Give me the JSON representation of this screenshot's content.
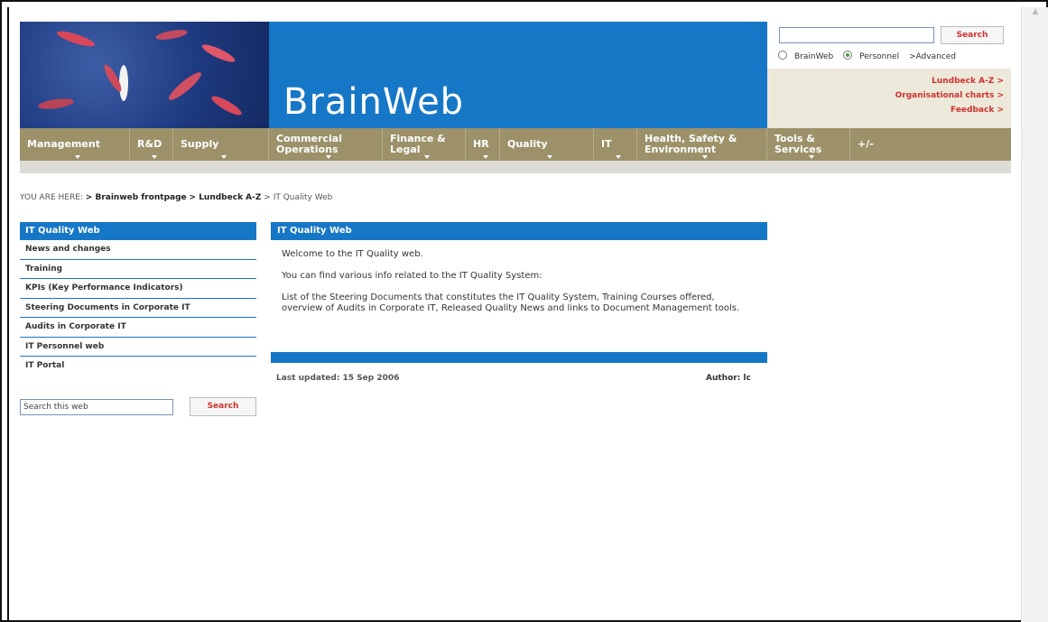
{
  "header": {
    "brand": "BrainWeb",
    "search": {
      "button": "Search",
      "value": ""
    },
    "scope_options": [
      "BrainWeb",
      "Personnel"
    ],
    "advanced": ">Advanced",
    "quick_links": [
      "Lundbeck A-Z >",
      "Organisational charts >",
      "Feedback >"
    ]
  },
  "nav": [
    "Management",
    "R&D",
    "Supply",
    "Commercial Operations",
    "Finance & Legal",
    "HR",
    "Quality",
    "IT",
    "Health, Safety & Environment",
    "Tools & Services",
    "+/-"
  ],
  "breadcrumb": {
    "prefix": "YOU ARE HERE:",
    "items": [
      "> Brainweb frontpage",
      "> Lundbeck A-Z",
      "> IT Quality Web"
    ]
  },
  "sidebar": {
    "title": "IT Quality Web",
    "items": [
      "News and changes",
      "Training",
      "KPIs (Key Performance Indicators)",
      "Steering Documents in Corporate IT",
      "Audits in Corporate IT",
      "IT Personnel web",
      "IT Portal"
    ],
    "search_value": "Search this web",
    "search_button": "Search"
  },
  "main": {
    "title": "IT Quality Web",
    "paragraphs": [
      "Welcome to the IT Quality web.",
      "You can find various info related to the IT Quality System:",
      "List of the Steering Documents that constitutes the IT Quality System, Training Courses offered, overview of Audits in Corporate IT, Released Quality News and links to Document Management tools."
    ],
    "updated": "Last updated: 15 Sep 2006",
    "author": "Author: lc"
  },
  "colors": {
    "accent_blue": "#1677c6",
    "nav_khaki": "#9c9169",
    "link_red": "#d0312d",
    "sand": "#ece8da"
  }
}
